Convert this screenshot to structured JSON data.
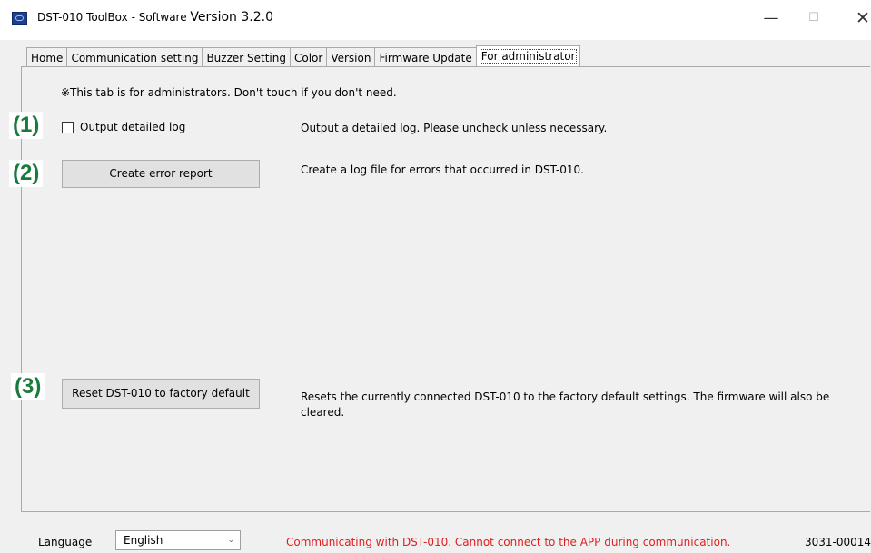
{
  "window": {
    "title_prefix": "DST-010 ToolBox - Software ",
    "title_version": "Version 3.2.0",
    "controls": {
      "minimize": "—",
      "maximize": "☐",
      "close": "✕"
    }
  },
  "tabs": [
    {
      "label": "Home"
    },
    {
      "label": "Communication setting"
    },
    {
      "label": "Buzzer Setting"
    },
    {
      "label": "Color"
    },
    {
      "label": "Version"
    },
    {
      "label": "Firmware Update"
    },
    {
      "label": "For administrator"
    }
  ],
  "admin": {
    "note": "※This tab is for administrators. Don't touch if you don't need.",
    "markers": [
      "(1)",
      "(2)",
      "(3)"
    ],
    "detailed_log": {
      "label": "Output detailed log",
      "checked": false,
      "description": "Output a detailed log. Please uncheck unless necessary."
    },
    "error_report": {
      "button": "Create error report",
      "description": "Create a log file for errors that occurred in DST-010."
    },
    "factory_reset": {
      "button": "Reset DST-010 to factory default",
      "description": "Resets the currently connected DST-010 to the factory default settings. The firmware will also be cleared."
    }
  },
  "status": {
    "language_label": "Language",
    "language_value": "English",
    "message": "Communicating with DST-010. Cannot connect to the APP during communication.",
    "serial": "3031-00014"
  }
}
